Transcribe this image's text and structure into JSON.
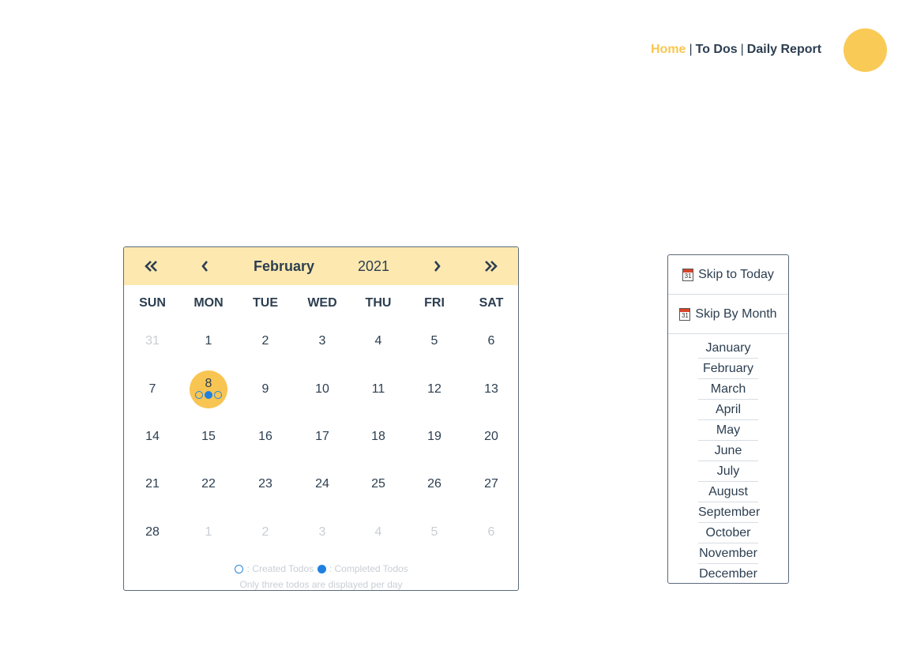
{
  "nav": {
    "items": [
      {
        "label": "Home",
        "active": true
      },
      {
        "label": "To Dos",
        "active": false
      },
      {
        "label": "Daily Report",
        "active": false
      }
    ],
    "separator": "|"
  },
  "calendar": {
    "month": "February",
    "year": "2021",
    "weekdays": [
      "SUN",
      "MON",
      "TUE",
      "WED",
      "THU",
      "FRI",
      "SAT"
    ],
    "weeks": [
      [
        {
          "d": "31",
          "muted": true
        },
        {
          "d": "1"
        },
        {
          "d": "2"
        },
        {
          "d": "3"
        },
        {
          "d": "4"
        },
        {
          "d": "5"
        },
        {
          "d": "6"
        }
      ],
      [
        {
          "d": "7"
        },
        {
          "d": "8",
          "selected": true,
          "created": 2,
          "completed": 1
        },
        {
          "d": "9"
        },
        {
          "d": "10"
        },
        {
          "d": "11"
        },
        {
          "d": "12"
        },
        {
          "d": "13"
        }
      ],
      [
        {
          "d": "14"
        },
        {
          "d": "15"
        },
        {
          "d": "16"
        },
        {
          "d": "17"
        },
        {
          "d": "18"
        },
        {
          "d": "19"
        },
        {
          "d": "20"
        }
      ],
      [
        {
          "d": "21"
        },
        {
          "d": "22"
        },
        {
          "d": "23"
        },
        {
          "d": "24"
        },
        {
          "d": "25"
        },
        {
          "d": "26"
        },
        {
          "d": "27"
        }
      ],
      [
        {
          "d": "28"
        },
        {
          "d": "1",
          "muted": true
        },
        {
          "d": "2",
          "muted": true
        },
        {
          "d": "3",
          "muted": true
        },
        {
          "d": "4",
          "muted": true
        },
        {
          "d": "5",
          "muted": true
        },
        {
          "d": "6",
          "muted": true
        }
      ]
    ],
    "legend": {
      "created_label": ": Created Todos",
      "completed_label": ": Completed Todos",
      "note": "Only three todos are displayed per day"
    },
    "icons": {
      "prev_year": "double-chevron-left-icon",
      "prev_month": "chevron-left-icon",
      "next_month": "chevron-right-icon",
      "next_year": "double-chevron-right-icon"
    }
  },
  "side": {
    "skip_today": "Skip to Today",
    "skip_month": "Skip By Month",
    "calendar_icon_text": "31",
    "months": [
      "January",
      "February",
      "March",
      "April",
      "May",
      "June",
      "July",
      "August",
      "September",
      "October",
      "November",
      "December"
    ]
  },
  "colors": {
    "accent": "#f9c74f",
    "header_bg": "#fde9b0",
    "text": "#2c3e50",
    "muted": "#c9ced4",
    "dot_blue": "#1f80e0"
  }
}
